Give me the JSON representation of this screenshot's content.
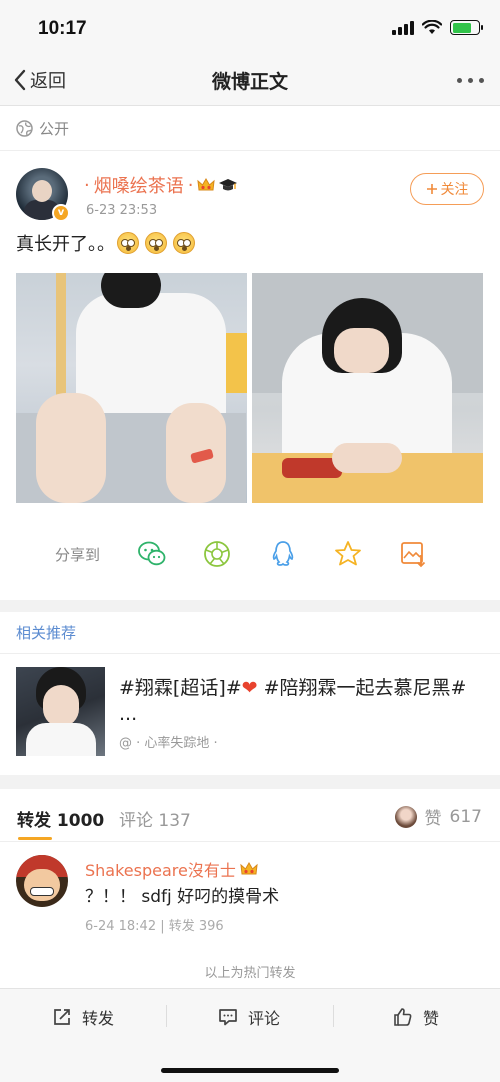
{
  "status_bar": {
    "time": "10:17"
  },
  "nav": {
    "back_label": "返回",
    "title": "微博正文"
  },
  "privacy": {
    "label": "公开"
  },
  "post": {
    "username": "烟嗓绘茶语",
    "time": "6-23 23:53",
    "follow_label": "关注",
    "text": "真长开了。。"
  },
  "share": {
    "label": "分享到"
  },
  "related": {
    "section_title": "相关推荐",
    "text_a": "#翔霖[超话]#",
    "text_b": "#陪翔霖一起去慕尼黑# ...",
    "sub": "@ · 心率失踪地 ·"
  },
  "tabs": {
    "repost_label": "转发",
    "repost_count": "1000",
    "comment_label": "评论",
    "comment_count": "137",
    "like_label": "赞",
    "like_count": "617"
  },
  "comment": {
    "username": "Shakespeare沒有士",
    "text": "？！！ sdfj 好叼的摸骨术",
    "meta": "6-24 18:42 | 转发 396"
  },
  "hot_note": "以上为热门转发",
  "bottom_bar": {
    "repost": "转发",
    "comment": "评论",
    "like": "赞"
  },
  "colors": {
    "accent_orange": "#eb7350",
    "link_blue": "#5b8bd0",
    "follow_border": "#f59d57"
  },
  "icons": [
    "back-chevron",
    "more-dots",
    "globe",
    "crown",
    "graduation-cap",
    "plus",
    "wechat",
    "moments",
    "qq",
    "qzone-star",
    "image-download",
    "repost",
    "comment",
    "thumbs-up"
  ]
}
